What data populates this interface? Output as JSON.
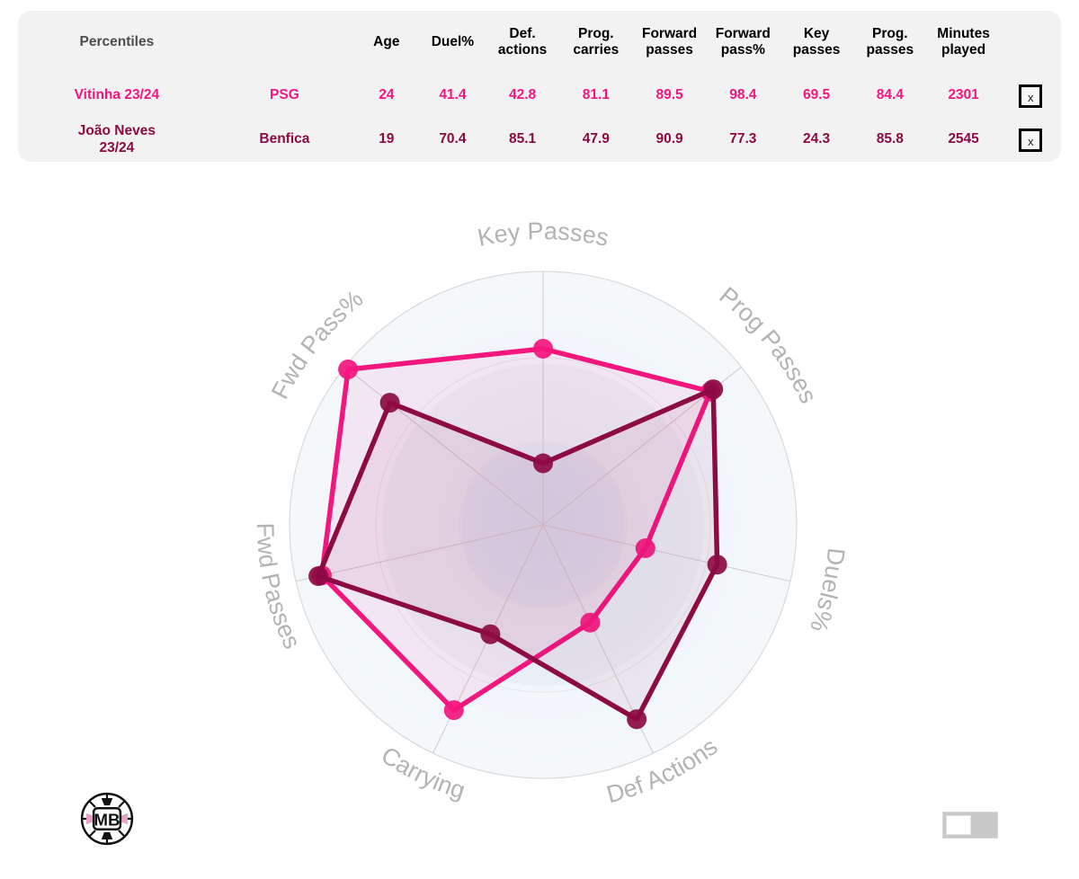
{
  "table": {
    "title": "Percentiles",
    "headers": [
      "Percentiles",
      "",
      "Age",
      "Duel%",
      "Def.\nactions",
      "Prog.\ncarries",
      "Forward\npasses",
      "Forward\npass%",
      "Key\npasses",
      "Prog.\npasses",
      "Minutes\nplayed",
      ""
    ],
    "headers_line1": {
      "h_age": "Age",
      "h_duel": "Duel%",
      "h_def1": "Def.",
      "h_def2": "actions",
      "h_prog_car1": "Prog.",
      "h_prog_car2": "carries",
      "h_fwd_pass1": "Forward",
      "h_fwd_pass2": "passes",
      "h_fwd_pct1": "Forward",
      "h_fwd_pct2": "pass%",
      "h_key1": "Key",
      "h_key2": "passes",
      "h_prog_pass1": "Prog.",
      "h_prog_pass2": "passes",
      "h_min1": "Minutes",
      "h_min2": "played"
    },
    "close_label": "x",
    "rows": [
      {
        "name": "Vitinha 23/24",
        "team": "PSG",
        "age": "24",
        "duel_pct": "41.4",
        "def_actions": "42.8",
        "prog_carries": "81.1",
        "forward_passes": "89.5",
        "forward_pass_pct": "98.4",
        "key_passes": "69.5",
        "prog_passes": "84.4",
        "minutes_played": "2301",
        "color": "#f4167f"
      },
      {
        "name_line1": "João Neves",
        "name_line2": "23/24",
        "name": "João Neves 23/24",
        "team": "Benfica",
        "age": "19",
        "duel_pct": "70.4",
        "def_actions": "85.1",
        "prog_carries": "47.9",
        "forward_passes": "90.9",
        "forward_pass_pct": "77.3",
        "key_passes": "24.3",
        "prog_passes": "85.8",
        "minutes_played": "2545",
        "color": "#8c0b42"
      }
    ]
  },
  "chart_data": {
    "type": "radar",
    "title": "",
    "axes": [
      "Key Passes",
      "Prog Passes",
      "Duels%",
      "Def Actions",
      "Carrying",
      "Fwd Passes",
      "Fwd Pass%"
    ],
    "axis_label_color": "#b3b3b3",
    "range": [
      0,
      100
    ],
    "grid": true,
    "legend_position": "none",
    "series": [
      {
        "name": "Vitinha 23/24",
        "color": "#f4167f",
        "values": [
          69.5,
          84.4,
          41.4,
          42.8,
          81.1,
          89.5,
          98.4
        ]
      },
      {
        "name": "João Neves 23/24",
        "color": "#8c0b42",
        "values": [
          24.3,
          85.8,
          70.4,
          85.1,
          47.9,
          90.9,
          77.3
        ]
      }
    ]
  },
  "footer": {
    "logo_text": "MB",
    "toggle_state": "off"
  },
  "colors": {
    "vitinha": "#f4167f",
    "joao": "#8c0b42",
    "panel_bg": "#f2f2f2",
    "axis_label": "#b3b3b3",
    "ring_outer": "#f3f7fa",
    "ring_mid": "#e8eef5",
    "ring_inner": "#dde7f1"
  }
}
